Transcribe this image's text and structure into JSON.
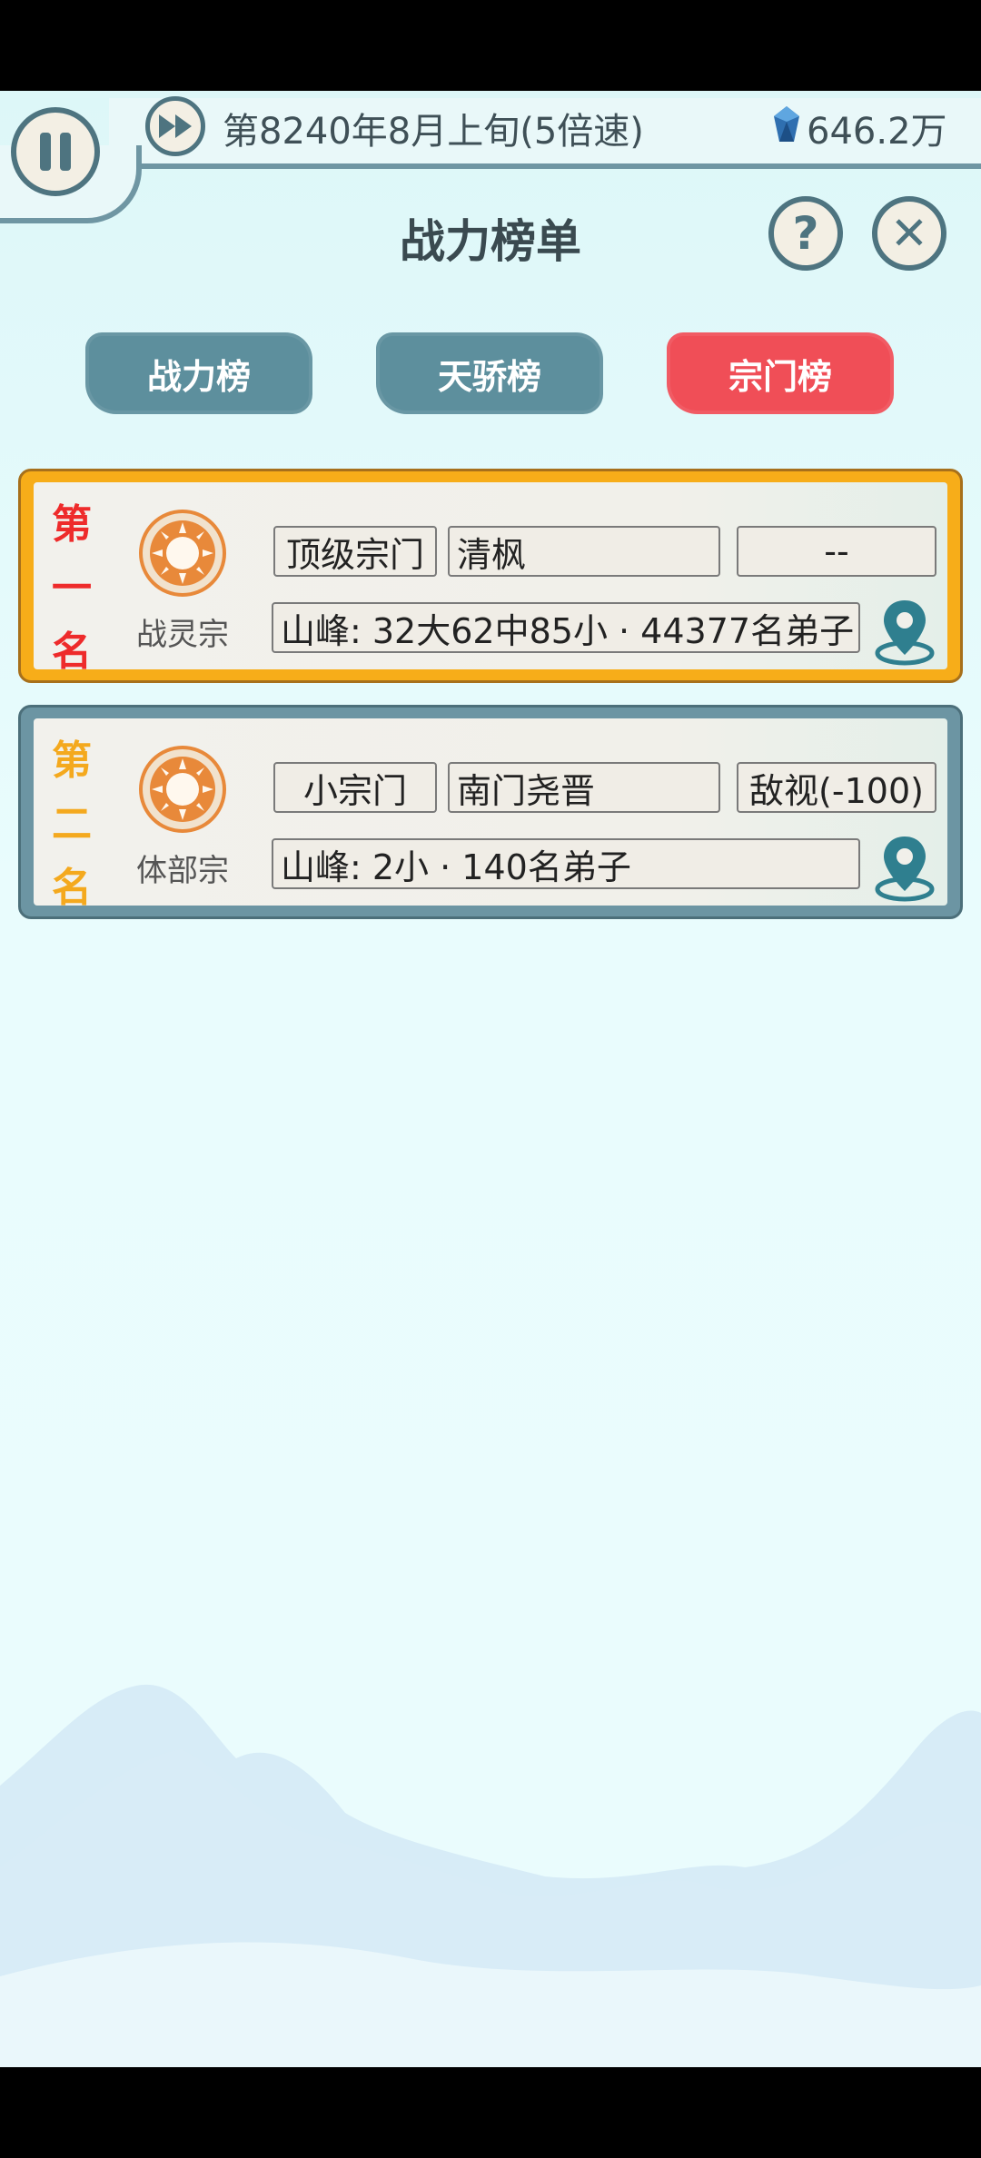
{
  "status": {
    "date_text": "第8240年8月上旬(5倍速)",
    "gem_text": "646.2万"
  },
  "header": {
    "title": "战力榜单",
    "help_glyph": "?",
    "close_glyph": "✕"
  },
  "tabs": [
    {
      "label": "战力榜",
      "active": false
    },
    {
      "label": "天骄榜",
      "active": false
    },
    {
      "label": "宗门榜",
      "active": true
    }
  ],
  "rankings": [
    {
      "rank_chars": [
        "第",
        "一",
        "名"
      ],
      "sect_name": "战灵宗",
      "tier": "顶级宗门",
      "leader": "清枫",
      "relation": "--",
      "peaks": "山峰: 32大62中85小 · 44377名弟子"
    },
    {
      "rank_chars": [
        "第",
        "二",
        "名"
      ],
      "sect_name": "体部宗",
      "tier": "小宗门",
      "leader": "南门尧晋",
      "relation": "敌视(-100)",
      "peaks": "山峰: 2小 · 140名弟子"
    }
  ],
  "colors": {
    "accent_red": "#f04e57",
    "tab_blue": "#5d8f9d",
    "gold_frame": "#f7ad19",
    "steel_frame": "#6c95a3"
  }
}
